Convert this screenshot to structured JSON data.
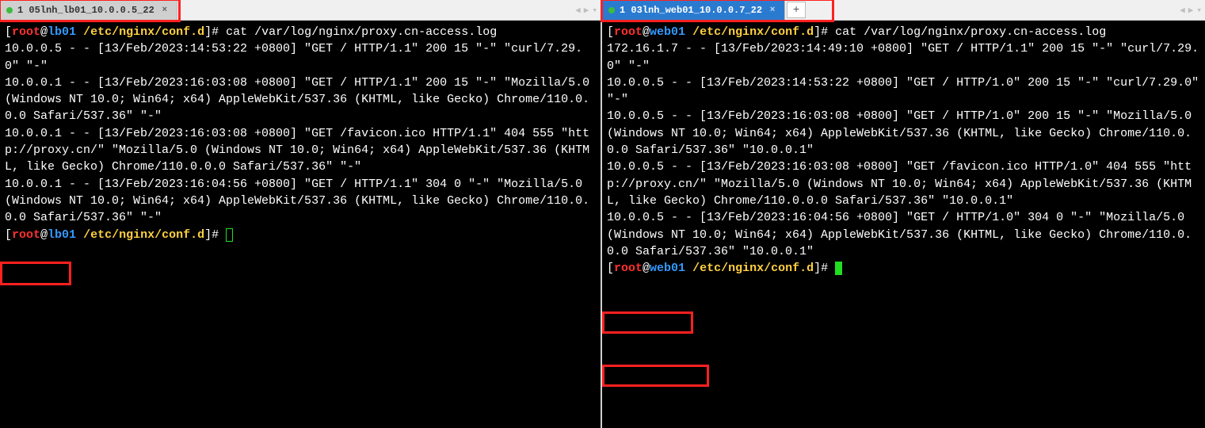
{
  "left": {
    "tab": {
      "label": "1 05lnh_lb01_10.0.0.5_22"
    },
    "prompt": {
      "user": "root",
      "host": "lb01",
      "path": "/etc/nginx/conf.d",
      "suffix": "]#"
    },
    "command": "cat /var/log/nginx/proxy.cn-access.log",
    "log": "10.0.0.5 - - [13/Feb/2023:14:53:22 +0800] \"GET / HTTP/1.1\" 200 15 \"-\" \"curl/7.29.0\" \"-\"\n10.0.0.1 - - [13/Feb/2023:16:03:08 +0800] \"GET / HTTP/1.1\" 200 15 \"-\" \"Mozilla/5.0 (Windows NT 10.0; Win64; x64) AppleWebKit/537.36 (KHTML, like Gecko) Chrome/110.0.0.0 Safari/537.36\" \"-\"\n10.0.0.1 - - [13/Feb/2023:16:03:08 +0800] \"GET /favicon.ico HTTP/1.1\" 404 555 \"http://proxy.cn/\" \"Mozilla/5.0 (Windows NT 10.0; Win64; x64) AppleWebKit/537.36 (KHTML, like Gecko) Chrome/110.0.0.0 Safari/537.36\" \"-\"\n10.0.0.1 - - [13/Feb/2023:16:04:56 +0800] \"GET / HTTP/1.1\" 304 0 \"-\" \"Mozilla/5.0 (Windows NT 10.0; Win64; x64) AppleWebKit/537.36 (KHTML, like Gecko) Chrome/110.0.0.0 Safari/537.36\" \"-\""
  },
  "right": {
    "tab": {
      "label": "1 03lnh_web01_10.0.0.7_22"
    },
    "add_tab": "+",
    "prompt": {
      "user": "root",
      "host": "web01",
      "path": "/etc/nginx/conf.d",
      "suffix": "]#"
    },
    "command": "cat /var/log/nginx/proxy.cn-access.log",
    "log": "172.16.1.7 - - [13/Feb/2023:14:49:10 +0800] \"GET / HTTP/1.1\" 200 15 \"-\" \"curl/7.29.0\" \"-\"\n10.0.0.5 - - [13/Feb/2023:14:53:22 +0800] \"GET / HTTP/1.0\" 200 15 \"-\" \"curl/7.29.0\" \"-\"\n10.0.0.5 - - [13/Feb/2023:16:03:08 +0800] \"GET / HTTP/1.0\" 200 15 \"-\" \"Mozilla/5.0 (Windows NT 10.0; Win64; x64) AppleWebKit/537.36 (KHTML, like Gecko) Chrome/110.0.0.0 Safari/537.36\" \"10.0.0.1\"\n10.0.0.5 - - [13/Feb/2023:16:03:08 +0800] \"GET /favicon.ico HTTP/1.0\" 404 555 \"http://proxy.cn/\" \"Mozilla/5.0 (Windows NT 10.0; Win64; x64) AppleWebKit/537.36 (KHTML, like Gecko) Chrome/110.0.0.0 Safari/537.36\" \"10.0.0.1\"\n10.0.0.5 - - [13/Feb/2023:16:04:56 +0800] \"GET / HTTP/1.0\" 304 0 \"-\" \"Mozilla/5.0 (Windows NT 10.0; Win64; x64) AppleWebKit/537.36 (KHTML, like Gecko) Chrome/110.0.0.0 Safari/537.36\" \"10.0.0.1\""
  },
  "nav_arrows": {
    "left": "◀",
    "right": "▶",
    "down": "▾"
  },
  "annotations": {
    "left_tab": "highlight around left tab",
    "left_ip": "highlight around 10.0.0.1",
    "right_tab": "highlight around right tab + add",
    "right_ip1": "highlight around 10.0.0.5",
    "right_ip2": "highlight around \"10.0.0.1\""
  }
}
